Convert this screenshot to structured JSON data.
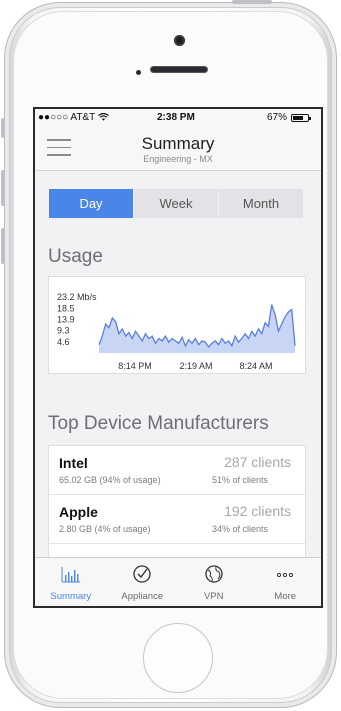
{
  "status_bar": {
    "carrier": "●●○○○ AT&T",
    "time": "2:38 PM",
    "battery": "67%"
  },
  "nav": {
    "title": "Summary",
    "subtitle": "Engineering - MX"
  },
  "segment": {
    "options": [
      "Day",
      "Week",
      "Month"
    ],
    "selected": "Day"
  },
  "usage": {
    "title": "Usage"
  },
  "chart_data": {
    "type": "area",
    "y_tick_labels": [
      "23.2 Mb/s",
      "18.5",
      "13.9",
      "9.3",
      "4.6"
    ],
    "x_tick_labels": [
      "8:14 PM",
      "2:19 AM",
      "8:24 AM"
    ],
    "ylim": [
      0,
      23.2
    ],
    "series": [
      {
        "color": "#5b7fdc",
        "x": [
          0,
          1,
          2,
          3,
          4,
          5,
          6,
          7,
          8,
          9,
          10,
          11,
          12,
          13,
          14,
          15,
          16,
          17,
          18,
          19,
          20,
          21,
          22,
          23,
          24,
          25,
          26,
          27,
          28,
          29,
          30,
          31,
          32,
          33,
          34,
          35,
          36,
          37,
          38,
          39,
          40,
          41,
          42,
          43,
          44,
          45,
          46,
          47,
          48,
          49,
          50,
          51,
          52,
          53,
          54,
          55,
          56,
          57,
          58,
          59
        ],
        "values": [
          3.5,
          7,
          12,
          10.5,
          14.5,
          13,
          8,
          10,
          7,
          8.5,
          6,
          9,
          7,
          5,
          8,
          6,
          7,
          4,
          6,
          5,
          7,
          4.5,
          6,
          5,
          4,
          6.5,
          3,
          5.5,
          4,
          6,
          3.5,
          5,
          4.5,
          2.5,
          4,
          5,
          3.5,
          6,
          4,
          5,
          3,
          7,
          4.5,
          6,
          8,
          6,
          9,
          7,
          10,
          8,
          12.5,
          11,
          20,
          16,
          9,
          12,
          15,
          17,
          18,
          3
        ]
      }
    ]
  },
  "manufacturers": {
    "title": "Top Device Manufacturers",
    "items": [
      {
        "name": "Intel",
        "usage": "65.02 GB (94% of usage)",
        "clients": "287 clients",
        "share": "51% of clients"
      },
      {
        "name": "Apple",
        "usage": "2.80 GB (4% of usage)",
        "clients": "192 clients",
        "share": "34% of clients"
      }
    ]
  },
  "tab_bar": {
    "tabs": [
      {
        "label": "Summary",
        "icon": "bar-chart-icon"
      },
      {
        "label": "Appliance",
        "icon": "check-circle-icon"
      },
      {
        "label": "VPN",
        "icon": "globe-icon"
      },
      {
        "label": "More",
        "icon": "more-dots-icon"
      }
    ],
    "active": "Summary"
  },
  "colors": {
    "accent": "#4a86e8",
    "chart_fill": "#c9d5f4",
    "chart_line": "#5b7fdc"
  }
}
